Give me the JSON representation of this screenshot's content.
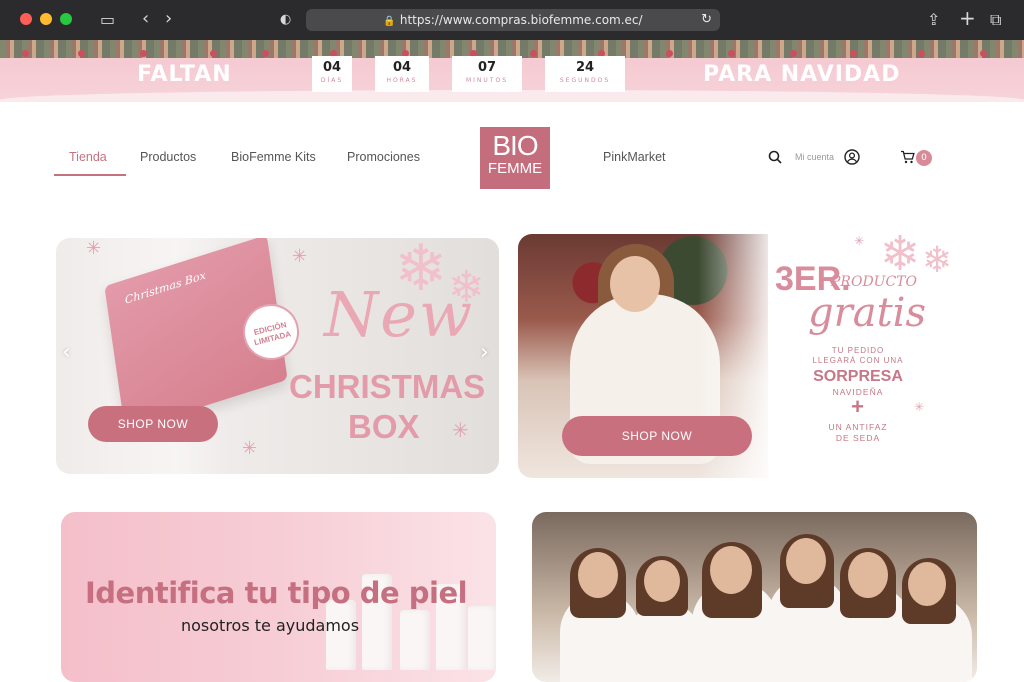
{
  "browser": {
    "url": "https://www.compras.biofemme.com.ec/"
  },
  "banner": {
    "left_text": "FALTAN",
    "right_text": "PARA NAVIDAD",
    "countdown": [
      {
        "value": "04",
        "label": "DÍAS"
      },
      {
        "value": "04",
        "label": "HORAS"
      },
      {
        "value": "07",
        "label": "MINUTOS"
      },
      {
        "value": "24",
        "label": "SEGUNDOS"
      }
    ]
  },
  "nav": {
    "items": [
      "Tienda",
      "Productos",
      "BioFemme Kits",
      "Promociones",
      "PinkMarket"
    ],
    "active": "Tienda",
    "logo_line1": "BIO",
    "logo_line2": "FEMME",
    "account_label": "Mi cuenta",
    "cart_count": "0"
  },
  "hero_left": {
    "box_label": "Christmas Box",
    "badge": "EDICIÓN LIMITADA",
    "script": "New",
    "title_line1": "CHRISTMAS",
    "title_line2": "BOX",
    "button": "SHOP NOW"
  },
  "hero_right": {
    "big": "3ER.",
    "producto": "PRODUCTO",
    "gratis": "gratis",
    "line1": "TU PEDIDO",
    "line2": "LLEGARÁ CON UNA",
    "line3": "SORPRESA",
    "line4": "NAVIDEÑA",
    "line5": "+",
    "line6": "UN ANTIFAZ",
    "line7": "DE SEDA",
    "button": "SHOP NOW"
  },
  "promo_skin": {
    "headline": "Identifica tu tipo de piel",
    "sub": "nosotros te ayudamos"
  },
  "colors": {
    "brand": "#c46d7c",
    "accent_pink": "#e39ba9",
    "banner_bg": "#f4c6cf"
  }
}
